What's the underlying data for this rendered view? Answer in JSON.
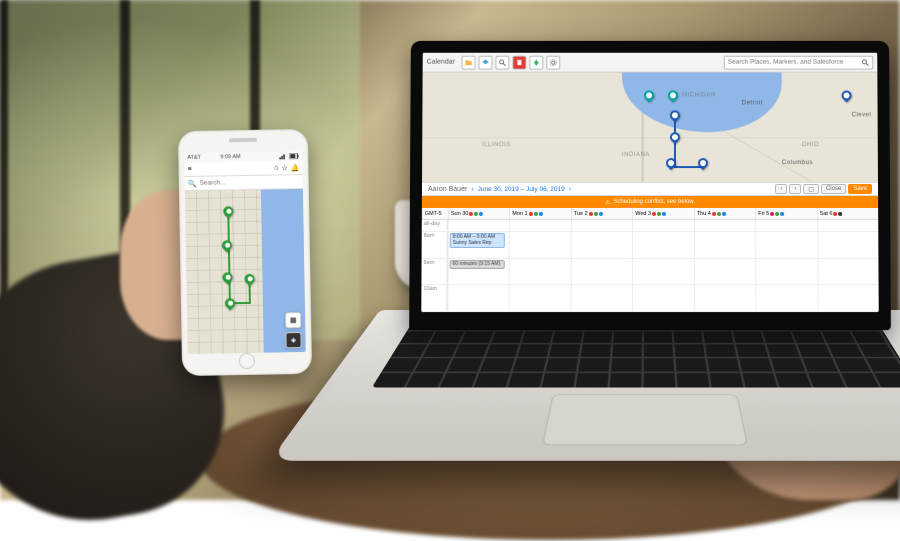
{
  "laptop": {
    "toolbar": {
      "title": "Calendar",
      "search_placeholder": "Search Places, Markers, and Salesforce"
    },
    "map": {
      "states": {
        "illinois": "ILLINOIS",
        "indiana": "INDIANA",
        "ohio": "OHIO",
        "michigan": "MICHIGAN"
      },
      "cities": {
        "detroit": "Detroit",
        "columbus": "Columbus",
        "cleveland": "Clevel"
      }
    },
    "range": {
      "user": "Aaron Bauer",
      "nav_prev": "‹",
      "nav_next": "›",
      "date_text": "June 30, 2019 – July 06, 2019",
      "prev": "‹",
      "next": "›",
      "today": "▢",
      "close": "Close",
      "save": "Save"
    },
    "warning": {
      "icon": "⚠",
      "text": "Scheduling conflict, see below."
    },
    "calendar": {
      "corner": "GMT-5",
      "days": [
        {
          "label": "Sun 30"
        },
        {
          "label": "Mon 1"
        },
        {
          "label": "Tue 2"
        },
        {
          "label": "Wed 3"
        },
        {
          "label": "Thu 4"
        },
        {
          "label": "Fri 5"
        },
        {
          "label": "Sat 6"
        }
      ],
      "allday": "all-day",
      "rows": [
        "8am",
        "9am",
        "10am"
      ],
      "events": {
        "sun_8": {
          "time": "8:00 AM – 9:00 AM",
          "title": "Sunny Sales Rep"
        },
        "sun_9": {
          "time": "60 minutes (9:15 AM)",
          "title": ""
        }
      }
    }
  },
  "phone": {
    "status": {
      "carrier": "AT&T",
      "time": "9:09 AM"
    },
    "nav": {
      "menu": "≡",
      "home": "⌂",
      "star": "☆",
      "bell": "🔔"
    },
    "search": {
      "icon": "🔍",
      "placeholder": "Search..."
    },
    "buttons": {
      "calendar": "▦",
      "locate": "◈"
    }
  }
}
